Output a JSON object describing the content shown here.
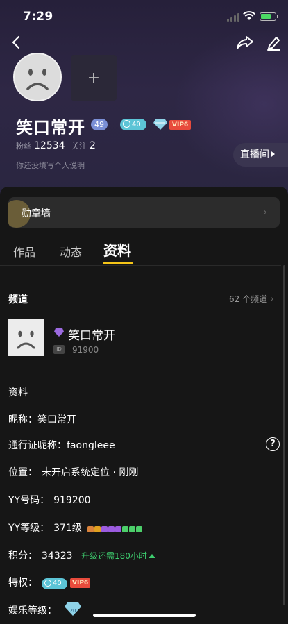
{
  "status_bar": {
    "time": "7:29"
  },
  "profile": {
    "name": "笑口常开",
    "level_badge": "49",
    "heart_badge": "40",
    "vip_badge": "VIP6",
    "fans_label": "粉丝",
    "fans_count": "12534",
    "follow_label": "关注",
    "follow_count": "2",
    "bio": "你还没填写个人说明",
    "add_photo": "+",
    "live_button": "直播间"
  },
  "medal_wall": {
    "label": "勋章墙",
    "chevron": "›"
  },
  "tabs": [
    {
      "label": "作品",
      "active": false
    },
    {
      "label": "动态",
      "active": false
    },
    {
      "label": "资料",
      "active": true
    }
  ],
  "channels": {
    "title": "频道",
    "count_text": "62 个频道",
    "chevron": "›",
    "item": {
      "name": "笑口常开",
      "id_badge": "ID",
      "id": "91900"
    }
  },
  "details": {
    "title": "资料",
    "nickname": {
      "label": "昵称：",
      "value": "笑口常开"
    },
    "passport": {
      "label": "通行证昵称：",
      "value": "faongleee",
      "help": "?"
    },
    "location": {
      "label": "位置：",
      "value": "未开启系统定位 · 刚刚"
    },
    "yy_number": {
      "label": "YY号码：",
      "value": "919200"
    },
    "yy_level": {
      "label": "YY等级：",
      "value": "371级",
      "level_icons": [
        "crown-bronze",
        "crown-gold",
        "moon-purple",
        "moon-purple",
        "moon-purple",
        "leaf-green",
        "leaf-green",
        "leaf-green"
      ],
      "level_icon_colors": [
        "#d9823b",
        "#e0a020",
        "#9c5ce0",
        "#9c5ce0",
        "#9c5ce0",
        "#4ccf6a",
        "#4ccf6a",
        "#4ccf6a"
      ]
    },
    "points": {
      "label": "积分：",
      "value": "34323",
      "upgrade_text": "升级还需180小时"
    },
    "privileges": {
      "label": "特权：",
      "heart_badge": "40",
      "vip_badge": "VIP6"
    },
    "entertainment_level": {
      "label": "娱乐等级：",
      "badge": "20"
    }
  },
  "colors": {
    "accent_underline": "#f5c518",
    "upgrade_green": "#3dcc6e",
    "vip_red": "#e84b3c",
    "heart_cyan": "#5cc4d6",
    "level_blue": "#7a8fd6"
  }
}
